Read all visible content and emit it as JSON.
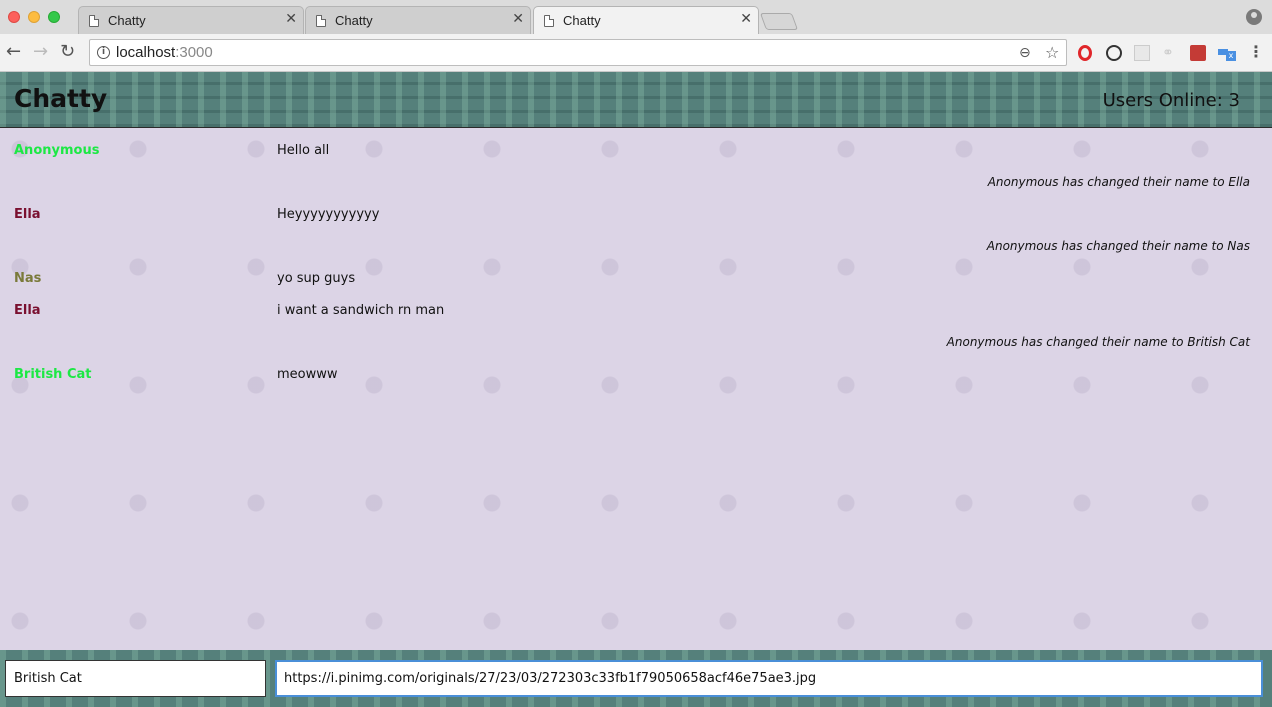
{
  "browser": {
    "tabs": [
      {
        "title": "Chatty",
        "active": false
      },
      {
        "title": "Chatty",
        "active": false
      },
      {
        "title": "Chatty",
        "active": true
      }
    ],
    "url_host": "localhost",
    "url_port": ":3000"
  },
  "app": {
    "title": "Chatty",
    "users_online": "Users Online: 3"
  },
  "messages": [
    {
      "type": "message",
      "user": "Anonymous",
      "color": "#1ce844",
      "text": "Hello all"
    },
    {
      "type": "notification",
      "text": "Anonymous has changed their name to Ella"
    },
    {
      "type": "message",
      "user": "Ella",
      "color": "#7a1030",
      "text": "Heyyyyyyyyyyy"
    },
    {
      "type": "notification",
      "text": "Anonymous has changed their name to Nas"
    },
    {
      "type": "message",
      "user": "Nas",
      "color": "#7a7a3a",
      "text": "yo sup guys"
    },
    {
      "type": "message",
      "user": "Ella",
      "color": "#7a1030",
      "text": "i want a sandwich rn man"
    },
    {
      "type": "notification",
      "text": "Anonymous has changed their name to British Cat"
    },
    {
      "type": "message",
      "user": "British Cat",
      "color": "#1ce844",
      "text": "meowww"
    }
  ],
  "compose": {
    "username": "British Cat",
    "message": "https://i.pinimg.com/originals/27/23/03/272303c33fb1f79050658acf46e75ae3.jpg"
  }
}
